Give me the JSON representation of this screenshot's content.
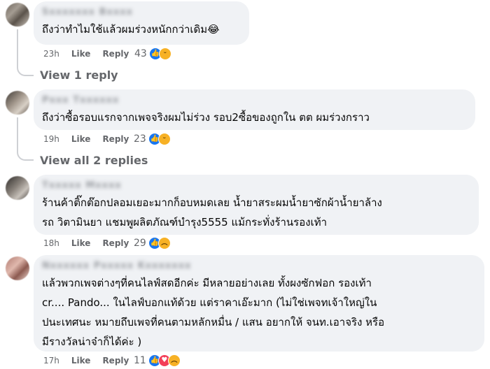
{
  "comments": [
    {
      "author": "Sxxxxxxx Bxxxx",
      "text": "ถึงว่าทำไมใช้แล้วผมร่วงหนักกว่าเดิม😂",
      "time": "23h",
      "like_label": "Like",
      "reply_label": "Reply",
      "reaction_count": "43",
      "reactions": [
        "like-icon",
        "haha-icon"
      ],
      "view_replies": "View 1 reply"
    },
    {
      "author": "Pxxx Txxxxxx",
      "text": "ถึงว่าซื้อรอบแรกจากเพจจริงผมไม่ร่วง รอบ2ซื้อของถูกใน ตต ผมร่วงกราว",
      "time": "19h",
      "like_label": "Like",
      "reply_label": "Reply",
      "reaction_count": "23",
      "reactions": [
        "like-icon",
        "haha-icon"
      ],
      "view_replies": "View all 2 replies"
    },
    {
      "author": "Txxxxx Mxxxx",
      "text": "ร้านค้าติ๊กต๊อกปลอมเยอะมากก็อบหมดเลย น้ำยาสระผมน้ำยาซักผ้าน้ำยาล้าง\nรถ วิตามินยา แชมพูผลิตภัณฑ์บำรุง5555 แม้กระทั่งร้านรองเท้า",
      "time": "18h",
      "like_label": "Like",
      "reply_label": "Reply",
      "reaction_count": "29",
      "reactions": [
        "like-icon",
        "sad-icon"
      ]
    },
    {
      "author": "Nxxxxxx Pxxxxx Kxxxxxxx",
      "text": "แล้วพวกเพจต่างๆที่คนไลฟ์สดอีกค่ะ มีหลายอย่างเลย ทั้งผงซักฟอก รองเท้า\ncr.... Pando... ในไลฟ์บอกแท้ด้วย แต่ราคาเอ๊ะมาก (ไม่ใช่เพจทเจ้าใหญ่ใน\nปนะเทศนะ หมายถึบเพจที่คนตามหลักหมื่น / แสน อยากให้ จนท.เอาจริง หรือ\nมีรางวัลน่าจ๋าก็ได้ค่ะ )",
      "time": "17h",
      "like_label": "Like",
      "reply_label": "Reply",
      "reaction_count": "11",
      "reactions": [
        "like-icon",
        "love-icon",
        "sad-icon"
      ]
    }
  ],
  "colors": {
    "bubble": "#f0f2f5",
    "meta": "#65676b",
    "like": "#1877f2",
    "love": "#f33e58",
    "emoji": "#f7b125"
  }
}
